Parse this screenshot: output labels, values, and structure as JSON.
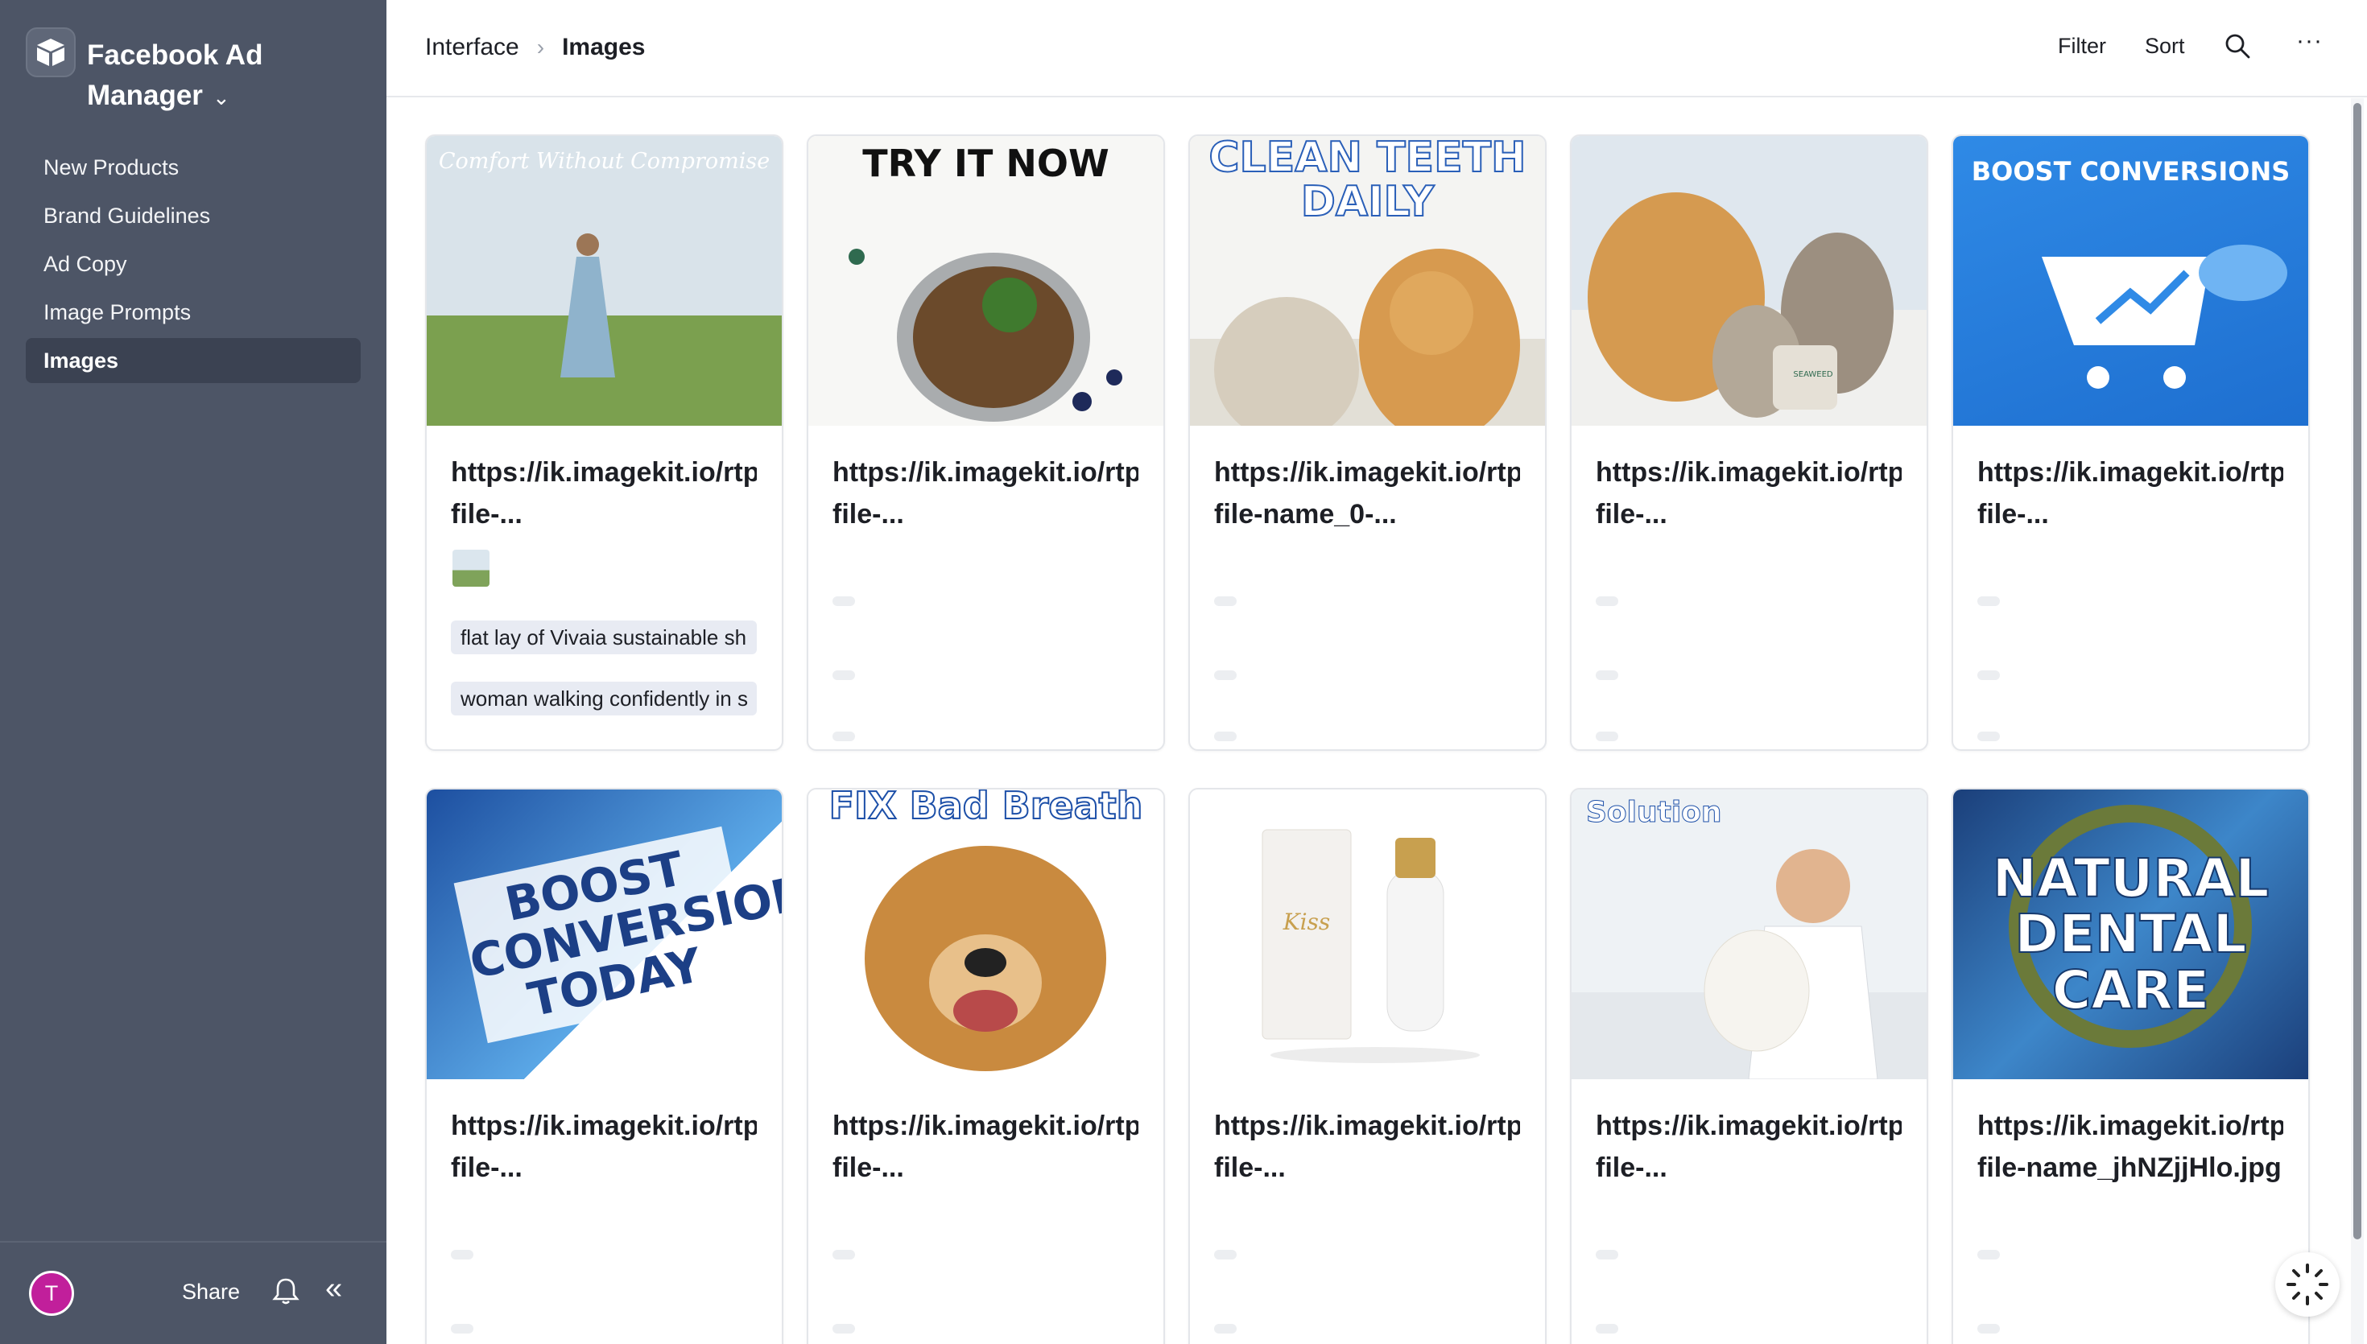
{
  "app": {
    "title": "Facebook Ad Manager",
    "icon": "box-logo-icon"
  },
  "sidebar": {
    "items": [
      {
        "label": "New Products"
      },
      {
        "label": "Brand Guidelines"
      },
      {
        "label": "Ad Copy"
      },
      {
        "label": "Image Prompts"
      },
      {
        "label": "Images",
        "active": true
      }
    ],
    "footer": {
      "avatar_initial": "T",
      "share_label": "Share"
    }
  },
  "breadcrumb": {
    "parent": "Interface",
    "current": "Images"
  },
  "toolbar": {
    "filter_label": "Filter",
    "sort_label": "Sort",
    "more_label": "···"
  },
  "cards": [
    {
      "image_caption": "Comfort Without Compromise",
      "url_line1": "https://ik.imagekit.io/rtpm",
      "url_line2": "file-...",
      "tags": [
        "flat lay of Vivaia sustainable sh",
        "woman walking confidently in s"
      ]
    },
    {
      "image_caption": "TRY IT NOW",
      "url_line1": "https://ik.imagekit.io/rtpm",
      "url_line2": "file-..."
    },
    {
      "image_caption": "CLEAN TEETH DAILY",
      "url_line1": "https://ik.imagekit.io/rtpm",
      "url_line2": "file-name_0-..."
    },
    {
      "image_caption": "SEAWEED",
      "url_line1": "https://ik.imagekit.io/rtpm",
      "url_line2": "file-..."
    },
    {
      "image_caption": "BOOST CONVERSIONS",
      "url_line1": "https://ik.imagekit.io/rtpm",
      "url_line2": "file-..."
    },
    {
      "image_caption": "BOOST CONVERSIONS TODAY",
      "url_line1": "https://ik.imagekit.io/rtpm",
      "url_line2": "file-..."
    },
    {
      "image_caption": "FIX Bad Breath",
      "url_line1": "https://ik.imagekit.io/rtpm",
      "url_line2": "file-..."
    },
    {
      "image_caption": "Kiss",
      "url_line1": "https://ik.imagekit.io/rtpm",
      "url_line2": "file-..."
    },
    {
      "image_caption": "Solution",
      "url_line1": "https://ik.imagekit.io/rtpm",
      "url_line2": "file-..."
    },
    {
      "image_caption": "NATURAL DENTAL CARE",
      "url_line1": "https://ik.imagekit.io/rtpm",
      "url_line2": "file-name_jhNZjjHlo.jpg"
    }
  ],
  "colors": {
    "sidebar_bg": "#4d5566",
    "active_item_bg": "#3b4252",
    "avatar_bg": "#c11f9b",
    "tag_bg": "#e8ebf3"
  }
}
